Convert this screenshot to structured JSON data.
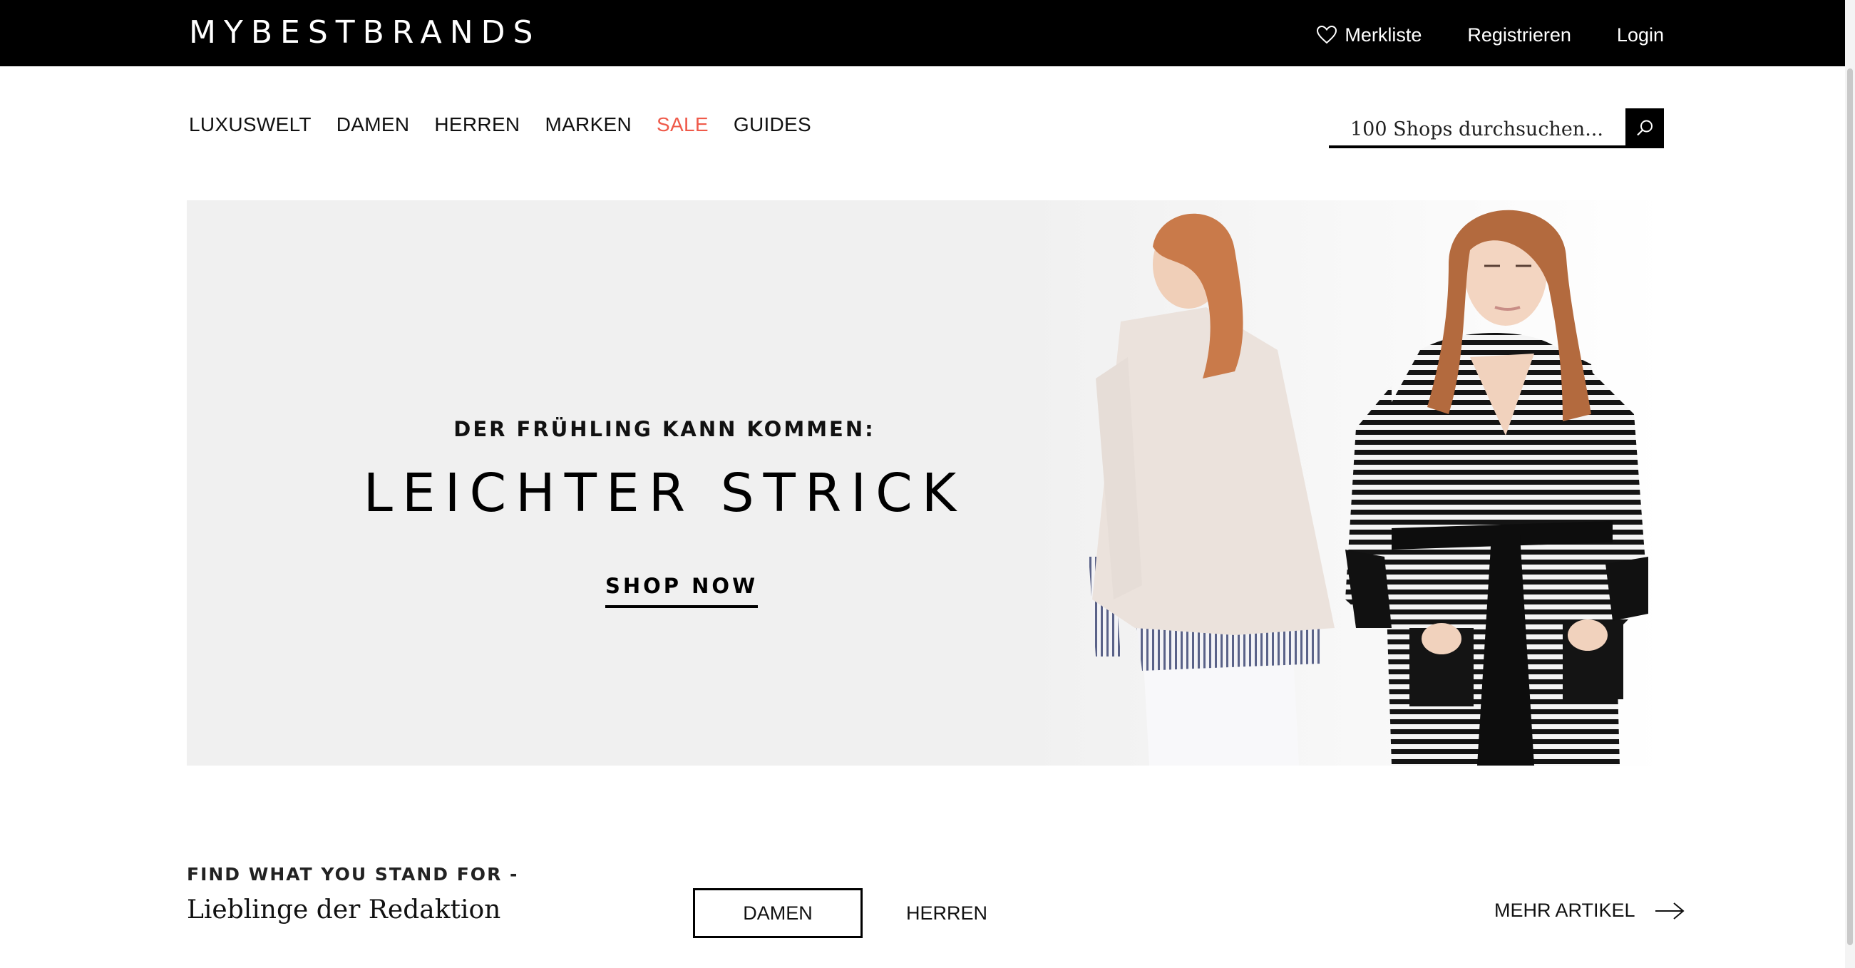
{
  "header": {
    "logo": "MYBESTBRANDS",
    "merkliste": "Merkliste",
    "registrieren": "Registrieren",
    "login": "Login"
  },
  "nav": {
    "items": [
      {
        "label": "LUXUSWELT"
      },
      {
        "label": "DAMEN"
      },
      {
        "label": "HERREN"
      },
      {
        "label": "MARKEN"
      },
      {
        "label": "SALE"
      },
      {
        "label": "GUIDES"
      }
    ],
    "sale_color": "#ef5a4a"
  },
  "search": {
    "placeholder": "100 Shops durchsuchen...",
    "icon": "search-icon"
  },
  "hero": {
    "kicker": "DER FRÜHLING KANN KOMMEN:",
    "title": "LEICHTER STRICK",
    "cta": "SHOP NOW",
    "background": "#f0f0f0"
  },
  "section": {
    "kicker": "FIND WHAT YOU STAND FOR -",
    "title": "Lieblinge der Redaktion",
    "tabs": [
      {
        "label": "DAMEN",
        "selected": true
      },
      {
        "label": "HERREN",
        "selected": false
      }
    ],
    "more": "MEHR ARTIKEL"
  },
  "colors": {
    "topbar": "#000000",
    "accent": "#ef5a4a"
  }
}
